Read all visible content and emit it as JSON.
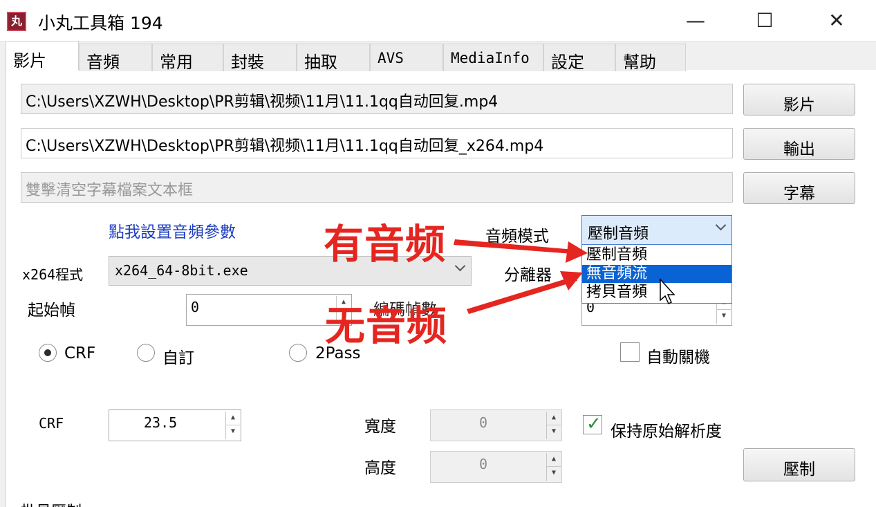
{
  "window": {
    "title": "小丸工具箱 194",
    "icon_glyph": "丸",
    "controls": {
      "minimize": "—",
      "maximize": "☐",
      "close": "✕"
    }
  },
  "tabs": [
    "影片",
    "音頻",
    "常用",
    "封裝",
    "抽取",
    "AVS",
    "MediaInfo",
    "設定",
    "幫助"
  ],
  "video_tab": {
    "input_path": "C:\\Users\\XZWH\\Desktop\\PR剪辑\\视频\\11月\\11.1qq自动回复.mp4",
    "input_button": "影片",
    "output_path": "C:\\Users\\XZWH\\Desktop\\PR剪辑\\视频\\11月\\11.1qq自动回复_x264.mp4",
    "output_button": "輸出",
    "subtitle_placeholder": "雙擊清空字幕檔案文本框",
    "subtitle_button": "字幕",
    "audio_settings_link": "點我設置音頻參數",
    "audio_mode_label": "音頻模式",
    "audio_mode_value": "壓制音頻",
    "audio_mode_options": [
      "壓制音頻",
      "無音頻流",
      "拷貝音頻"
    ],
    "audio_mode_highlighted_index": 1,
    "x264_label": "x264程式",
    "x264_value": "x264_64-8bit.exe",
    "demuxer_label": "分離器",
    "start_frame_label": "起始幀",
    "start_frame_value": "0",
    "encode_frames_label": "編碼幀數",
    "encode_frames_value": "0",
    "rate_modes": [
      "CRF",
      "自訂",
      "2Pass"
    ],
    "rate_mode_selected": "CRF",
    "auto_shutdown_label": "自動關機",
    "auto_shutdown_checked": false,
    "crf_label": "CRF",
    "crf_value": "23.5",
    "width_label": "寬度",
    "width_value": "0",
    "height_label": "高度",
    "height_value": "0",
    "keep_resolution_label": "保持原始解析度",
    "keep_resolution_checked": true,
    "encode_button": "壓制",
    "batch_label": "批量壓制"
  },
  "annotations": {
    "with_audio": "有音频",
    "no_audio": "无音频",
    "color": "#e52620"
  }
}
